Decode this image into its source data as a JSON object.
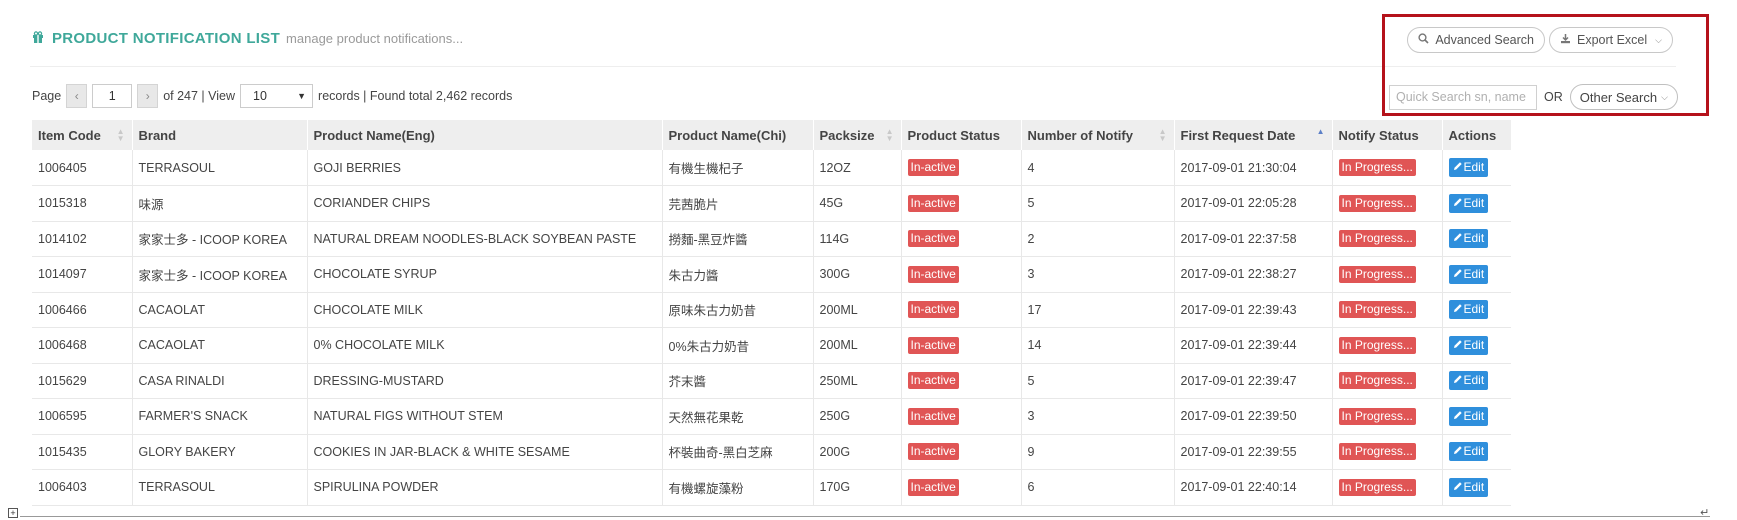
{
  "header": {
    "icon": "gift-icon",
    "title": "PRODUCT NOTIFICATION LIST",
    "subtitle": "manage product notifications..."
  },
  "toolbar": {
    "advanced_search": "Advanced Search",
    "export_excel": "Export Excel"
  },
  "pagination": {
    "page_label": "Page",
    "current_page": "1",
    "of_pages": "of 247 | View",
    "view_count": "10",
    "records_text": "records | Found total 2,462 records"
  },
  "quick_search": {
    "placeholder": "Quick Search sn, name",
    "or_label": "OR",
    "other_search": "Other Search"
  },
  "table": {
    "columns": [
      "Item Code",
      "Brand",
      "Product Name(Eng)",
      "Product Name(Chi)",
      "Packsize",
      "Product Status",
      "Number of Notify",
      "First Request Date",
      "Notify Status",
      "Actions"
    ],
    "edit_label": "Edit",
    "rows": [
      {
        "code": "1006405",
        "brand": "TERRASOUL",
        "name_eng": "GOJI BERRIES",
        "name_chi": "有機生機杞子",
        "packsize": "12OZ",
        "status": "In-active",
        "notify": "4",
        "date": "2017-09-01 21:30:04",
        "notify_status": "In Progress..."
      },
      {
        "code": "1015318",
        "brand": "味源",
        "name_eng": "CORIANDER CHIPS",
        "name_chi": "芫茜脆片",
        "packsize": "45G",
        "status": "In-active",
        "notify": "5",
        "date": "2017-09-01 22:05:28",
        "notify_status": "In Progress..."
      },
      {
        "code": "1014102",
        "brand": "家家士多 - ICOOP KOREA",
        "name_eng": "NATURAL DREAM NOODLES-BLACK SOYBEAN PASTE",
        "name_chi": "撈麵-黑豆炸醬",
        "packsize": "114G",
        "status": "In-active",
        "notify": "2",
        "date": "2017-09-01 22:37:58",
        "notify_status": "In Progress..."
      },
      {
        "code": "1014097",
        "brand": "家家士多 - ICOOP KOREA",
        "name_eng": "CHOCOLATE SYRUP",
        "name_chi": "朱古力醬",
        "packsize": "300G",
        "status": "In-active",
        "notify": "3",
        "date": "2017-09-01 22:38:27",
        "notify_status": "In Progress..."
      },
      {
        "code": "1006466",
        "brand": "CACAOLAT",
        "name_eng": "CHOCOLATE MILK",
        "name_chi": "原味朱古力奶昔",
        "packsize": "200ML",
        "status": "In-active",
        "notify": "17",
        "date": "2017-09-01 22:39:43",
        "notify_status": "In Progress..."
      },
      {
        "code": "1006468",
        "brand": "CACAOLAT",
        "name_eng": "0% CHOCOLATE MILK",
        "name_chi": "0%朱古力奶昔",
        "packsize": "200ML",
        "status": "In-active",
        "notify": "14",
        "date": "2017-09-01 22:39:44",
        "notify_status": "In Progress..."
      },
      {
        "code": "1015629",
        "brand": "CASA RINALDI",
        "name_eng": "DRESSING-MUSTARD",
        "name_chi": "芥末醬",
        "packsize": "250ML",
        "status": "In-active",
        "notify": "5",
        "date": "2017-09-01 22:39:47",
        "notify_status": "In Progress..."
      },
      {
        "code": "1006595",
        "brand": "FARMER'S SNACK",
        "name_eng": "NATURAL FIGS WITHOUT STEM",
        "name_chi": "天然無花果乾",
        "packsize": "250G",
        "status": "In-active",
        "notify": "3",
        "date": "2017-09-01 22:39:50",
        "notify_status": "In Progress..."
      },
      {
        "code": "1015435",
        "brand": "GLORY BAKERY",
        "name_eng": "COOKIES IN JAR-BLACK & WHITE SESAME",
        "name_chi": "杯裝曲奇-黑白芝麻",
        "packsize": "200G",
        "status": "In-active",
        "notify": "9",
        "date": "2017-09-01 22:39:55",
        "notify_status": "In Progress..."
      },
      {
        "code": "1006403",
        "brand": "TERRASOUL",
        "name_eng": "SPIRULINA POWDER",
        "name_chi": "有機螺旋藻粉",
        "packsize": "170G",
        "status": "In-active",
        "notify": "6",
        "date": "2017-09-01 22:40:14",
        "notify_status": "In Progress..."
      }
    ]
  }
}
